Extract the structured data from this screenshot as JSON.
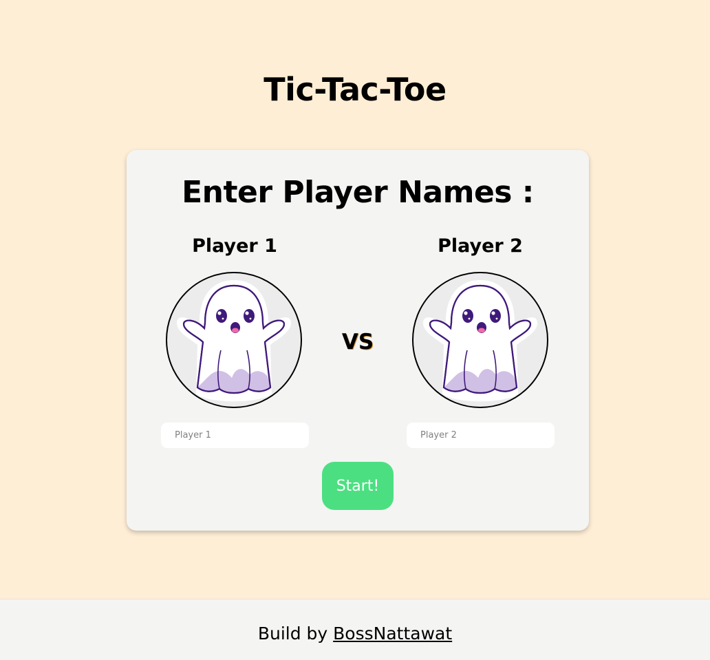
{
  "header": {
    "title": "Tic-Tac-Toe"
  },
  "card": {
    "title": "Enter Player Names :",
    "vs_label": "VS",
    "players": [
      {
        "label": "Player 1",
        "input_placeholder": "Player 1",
        "input_value": "",
        "avatar_icon": "ghost-icon"
      },
      {
        "label": "Player 2",
        "input_placeholder": "Player 2",
        "input_value": "",
        "avatar_icon": "ghost-icon"
      }
    ],
    "start_label": "Start!"
  },
  "footer": {
    "prefix": "Build by",
    "author_link": "BossNattawat"
  },
  "colors": {
    "page_background": "#ffeed6",
    "card_background": "#f4f4f2",
    "start_button": "#4cdf82",
    "ghost_outline": "#3f1a7a",
    "ghost_accent": "#c9b5e0"
  }
}
